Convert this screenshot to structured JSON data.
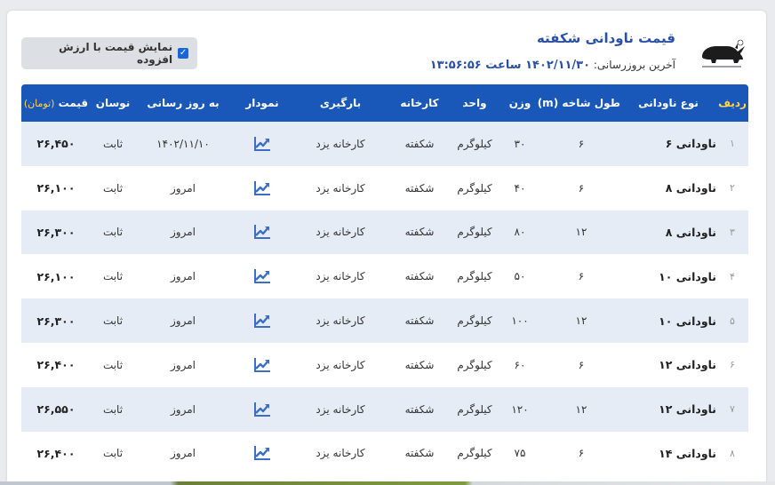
{
  "page": {
    "title": "قیمت ناودانی شکفته",
    "updated_label": "آخرین بروزرسانی:",
    "updated_value": "۱۴۰۲/۱۱/۳۰ ساعت ۱۳:۵۶:۵۶",
    "vat_toggle_label": "نمایش قیمت با ارزش افزوده",
    "vat_toggle_checked": true
  },
  "colors": {
    "header_bg": "#1957b8",
    "title": "#2a50a5",
    "alt_row": "#e6ecf5",
    "unit_highlight": "#ffd54a",
    "chart_icon": "#3a6fc4"
  },
  "table": {
    "headers": {
      "rownum": "ردیف",
      "type": "نوع ناودانی",
      "length": "طول شاخه (m)",
      "weight": "وزن",
      "unit": "واحد",
      "factory": "کارخانه",
      "loading": "بارگیری",
      "chart": "نمودار",
      "updated": "به روز رسانی",
      "fluctuation": "نوسان",
      "price": "قیمت",
      "price_unit": "(تومان)"
    },
    "rows": [
      {
        "n": "۱",
        "type": "ناودانی ۶",
        "length": "۶",
        "weight": "۳۰",
        "unit": "کیلوگرم",
        "factory": "شکفته",
        "loading": "کارخانه یزد",
        "chart_icon": "trend-chart-icon",
        "updated": "۱۴۰۲/۱۱/۱۰",
        "fluctuation": "ثابت",
        "price": "۲۶,۴۵۰"
      },
      {
        "n": "۲",
        "type": "ناودانی ۸",
        "length": "۶",
        "weight": "۴۰",
        "unit": "کیلوگرم",
        "factory": "شکفته",
        "loading": "کارخانه یزد",
        "chart_icon": "trend-chart-icon",
        "updated": "امروز",
        "fluctuation": "ثابت",
        "price": "۲۶,۱۰۰"
      },
      {
        "n": "۳",
        "type": "ناودانی ۸",
        "length": "۱۲",
        "weight": "۸۰",
        "unit": "کیلوگرم",
        "factory": "شکفته",
        "loading": "کارخانه یزد",
        "chart_icon": "trend-chart-icon",
        "updated": "امروز",
        "fluctuation": "ثابت",
        "price": "۲۶,۳۰۰"
      },
      {
        "n": "۴",
        "type": "ناودانی ۱۰",
        "length": "۶",
        "weight": "۵۰",
        "unit": "کیلوگرم",
        "factory": "شکفته",
        "loading": "کارخانه یزد",
        "chart_icon": "trend-chart-icon",
        "updated": "امروز",
        "fluctuation": "ثابت",
        "price": "۲۶,۱۰۰"
      },
      {
        "n": "۵",
        "type": "ناودانی ۱۰",
        "length": "۱۲",
        "weight": "۱۰۰",
        "unit": "کیلوگرم",
        "factory": "شکفته",
        "loading": "کارخانه یزد",
        "chart_icon": "trend-chart-icon",
        "updated": "امروز",
        "fluctuation": "ثابت",
        "price": "۲۶,۳۰۰"
      },
      {
        "n": "۶",
        "type": "ناودانی ۱۲",
        "length": "۶",
        "weight": "۶۰",
        "unit": "کیلوگرم",
        "factory": "شکفته",
        "loading": "کارخانه یزد",
        "chart_icon": "trend-chart-icon",
        "updated": "امروز",
        "fluctuation": "ثابت",
        "price": "۲۶,۴۰۰"
      },
      {
        "n": "۷",
        "type": "ناودانی ۱۲",
        "length": "۱۲",
        "weight": "۱۲۰",
        "unit": "کیلوگرم",
        "factory": "شکفته",
        "loading": "کارخانه یزد",
        "chart_icon": "trend-chart-icon",
        "updated": "امروز",
        "fluctuation": "ثابت",
        "price": "۲۶,۵۵۰"
      },
      {
        "n": "۸",
        "type": "ناودانی ۱۴",
        "length": "۶",
        "weight": "۷۵",
        "unit": "کیلوگرم",
        "factory": "شکفته",
        "loading": "کارخانه یزد",
        "chart_icon": "trend-chart-icon",
        "updated": "امروز",
        "fluctuation": "ثابت",
        "price": "۲۶,۴۰۰"
      }
    ]
  }
}
